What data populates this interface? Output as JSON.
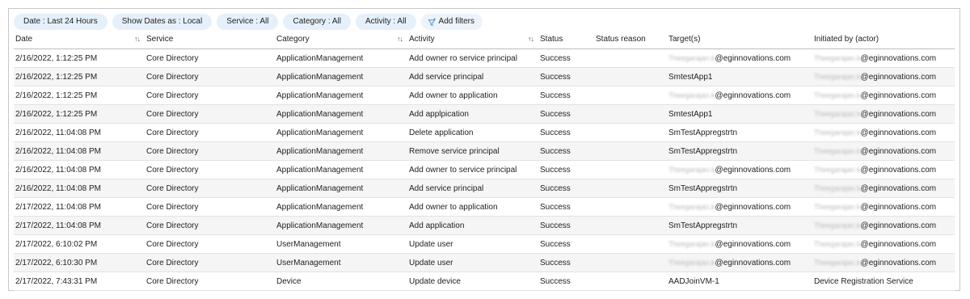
{
  "filters": [
    {
      "label": "Date : Last 24 Hours"
    },
    {
      "label": "Show Dates as : Local"
    },
    {
      "label": "Service : All"
    },
    {
      "label": "Category : All"
    },
    {
      "label": "Activity : All"
    }
  ],
  "add_filters_label": "Add filters",
  "columns": [
    {
      "label": "Date",
      "sortable": true
    },
    {
      "label": "Service",
      "sortable": false
    },
    {
      "label": "Category",
      "sortable": true
    },
    {
      "label": "Activity",
      "sortable": true
    },
    {
      "label": "Status",
      "sortable": false
    },
    {
      "label": "Status reason",
      "sortable": false
    },
    {
      "label": "Target(s)",
      "sortable": false
    },
    {
      "label": "Initiated by (actor)",
      "sortable": false
    }
  ],
  "sort_glyph": "↑↓",
  "redacted_name": "Theegarajan.k",
  "rows": [
    {
      "date": "2/16/2022, 1:12:25 PM",
      "service": "Core Directory",
      "category": "ApplicationManagement",
      "activity": "Add owner ro service principal",
      "status": "Success",
      "status_reason": "",
      "target": "@eginnovations.com",
      "target_redacted": true,
      "actor": "@eginnovations.com",
      "actor_redacted": true
    },
    {
      "date": "2/16/2022, 1:12:25 PM",
      "service": "Core Directory",
      "category": "ApplicationManagement",
      "activity": "Add service principal",
      "status": "Success",
      "status_reason": "",
      "target": "SmtestApp1",
      "target_redacted": false,
      "actor": "@eginnovations.com",
      "actor_redacted": true
    },
    {
      "date": "2/16/2022, 1:12:25 PM",
      "service": "Core Directory",
      "category": "ApplicationManagement",
      "activity": "Add owner to application",
      "status": "Success",
      "status_reason": "",
      "target": "@eginnovations.com",
      "target_redacted": true,
      "actor": "@eginnovations.com",
      "actor_redacted": true
    },
    {
      "date": "2/16/2022, 1:12:25 PM",
      "service": "Core Directory",
      "category": "ApplicationManagement",
      "activity": "Add applpication",
      "status": "Success",
      "status_reason": "",
      "target": "SmtestApp1",
      "target_redacted": false,
      "actor": "@eginnovations.com",
      "actor_redacted": true
    },
    {
      "date": "2/16/2022, 11:04:08 PM",
      "service": "Core Directory",
      "category": "ApplicationManagement",
      "activity": "Delete application",
      "status": "Success",
      "status_reason": "",
      "target": "SmTestAppregstrtn",
      "target_redacted": false,
      "actor": "@eginnovations.com",
      "actor_redacted": true
    },
    {
      "date": "2/16/2022, 11:04:08 PM",
      "service": "Core Directory",
      "category": "ApplicationManagement",
      "activity": "Remove service principal",
      "status": "Success",
      "status_reason": "",
      "target": "SmTestAppregstrtn",
      "target_redacted": false,
      "actor": "@eginnovations.com",
      "actor_redacted": true
    },
    {
      "date": "2/16/2022, 11:04:08 PM",
      "service": "Core Directory",
      "category": "ApplicationManagement",
      "activity": "Add owner to service principal",
      "status": "Success",
      "status_reason": "",
      "target": "@eginnovations.com",
      "target_redacted": true,
      "actor": "@eginnovations.com",
      "actor_redacted": true
    },
    {
      "date": "2/16/2022, 11:04:08 PM",
      "service": "Core Directory",
      "category": "ApplicationManagement",
      "activity": "Add service principal",
      "status": "Success",
      "status_reason": "",
      "target": "SmTestAppregstrtn",
      "target_redacted": false,
      "actor": "@eginnovations.com",
      "actor_redacted": true
    },
    {
      "date": "2/17/2022, 11:04:08 PM",
      "service": "Core Directory",
      "category": "ApplicationManagement",
      "activity": "Add owner to application",
      "status": "Success",
      "status_reason": "",
      "target": "@eginnovations.com",
      "target_redacted": true,
      "actor": "@eginnovations.com",
      "actor_redacted": true
    },
    {
      "date": "2/17/2022, 11:04:08 PM",
      "service": "Core Directory",
      "category": "ApplicationManagement",
      "activity": "Add application",
      "status": "Success",
      "status_reason": "",
      "target": "SmTestAppregstrtn",
      "target_redacted": false,
      "actor": "@eginnovations.com",
      "actor_redacted": true
    },
    {
      "date": "2/17/2022, 6:10:02 PM",
      "service": "Core Directory",
      "category": "UserManagement",
      "activity": "Update user",
      "status": "Success",
      "status_reason": "",
      "target": "@eginnovations.com",
      "target_redacted": true,
      "actor": "@eginnovations.com",
      "actor_redacted": true
    },
    {
      "date": "2/17/2022, 6:10:30 PM",
      "service": "Core Directory",
      "category": "UserManagement",
      "activity": "Update user",
      "status": "Success",
      "status_reason": "",
      "target": "@eginnovations.com",
      "target_redacted": true,
      "actor": "@eginnovations.com",
      "actor_redacted": true
    },
    {
      "date": "2/17/2022, 7:43:31 PM",
      "service": "Core Directory",
      "category": "Device",
      "activity": "Update device",
      "status": "Success",
      "status_reason": "",
      "target": "AADJoinVM-1",
      "target_redacted": false,
      "actor": "Device Registration Service",
      "actor_redacted": false
    }
  ],
  "colors": {
    "pill_bg": "#e6f0fb",
    "border": "#c8c8c8",
    "alt_row": "#f5f5f5",
    "filter_icon": "#4a8fd4"
  }
}
